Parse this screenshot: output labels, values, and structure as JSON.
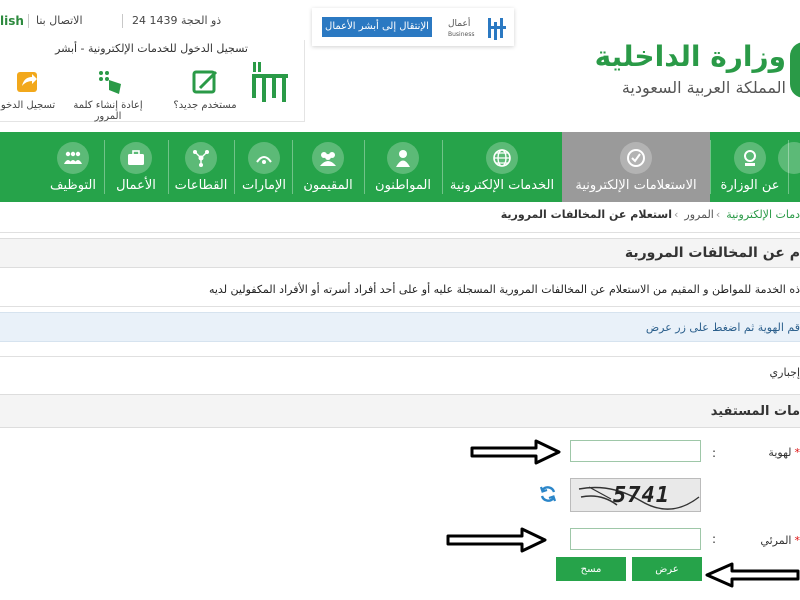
{
  "topbar": {
    "language_link": "lish",
    "contact": "الاتصال بنا",
    "date": "24 ذو الحجة 1439"
  },
  "login": {
    "title": "تسجيل الدخول للخدمات الإلكترونية - أبشر",
    "new_user": "مستخدم جديد؟",
    "reset_password": "إعادة إنشاء كلمة المرور",
    "register": "تسجيل الدخو"
  },
  "business": {
    "button": "الإنتقال إلى أبشر الأعمال",
    "logo_text": "أعمال",
    "logo_sub": "Business"
  },
  "ministry": {
    "name": "وزارة الداخلية",
    "country": "المملكة العربية السعودية"
  },
  "nav": {
    "items": [
      {
        "label": "عن الوزارة",
        "icon": "emblem-icon"
      },
      {
        "label": "الاستعلامات الإلكترونية",
        "icon": "info-inquiries-icon",
        "active": true
      },
      {
        "label": "الخدمات الإلكترونية",
        "icon": "globe-icon"
      },
      {
        "label": "المواطنون",
        "icon": "citizen-icon"
      },
      {
        "label": "المقيمون",
        "icon": "residents-icon"
      },
      {
        "label": "الإمارات",
        "icon": "emirates-icon"
      },
      {
        "label": "القطاعات",
        "icon": "sectors-icon"
      },
      {
        "label": "الأعمال",
        "icon": "briefcase-icon"
      },
      {
        "label": "التوظيف",
        "icon": "employment-icon"
      }
    ]
  },
  "breadcrumb": {
    "items": [
      "دمات الإلكترونية",
      "المرور",
      "استعلام عن المخالفات المرورية"
    ]
  },
  "page": {
    "title": "م عن المخالفات المرورية",
    "description": "ذه الخدمة للمواطن و المقيم من الاستعلام عن المخالفات المرورية المسجلة عليه أو على أحد أفراد أسرته أو الأفراد المكفولين لديه",
    "info": "قم الهوية ثم اضغط على زر عرض",
    "required_note": "إجباري",
    "section_title": "مات المستفيد"
  },
  "form": {
    "id_label": "لهوية",
    "id_value": "",
    "captcha_text": "5741",
    "code_label": "المرئي",
    "code_value": "",
    "colon": ":",
    "required_mark": "*",
    "show_button": "عرض",
    "clear_button": "مسح"
  },
  "colors": {
    "brand_green": "#26a34a",
    "active_nav": "#9a9a9a",
    "info_bg": "#e9f1f9",
    "business_blue": "#2b79c2"
  }
}
